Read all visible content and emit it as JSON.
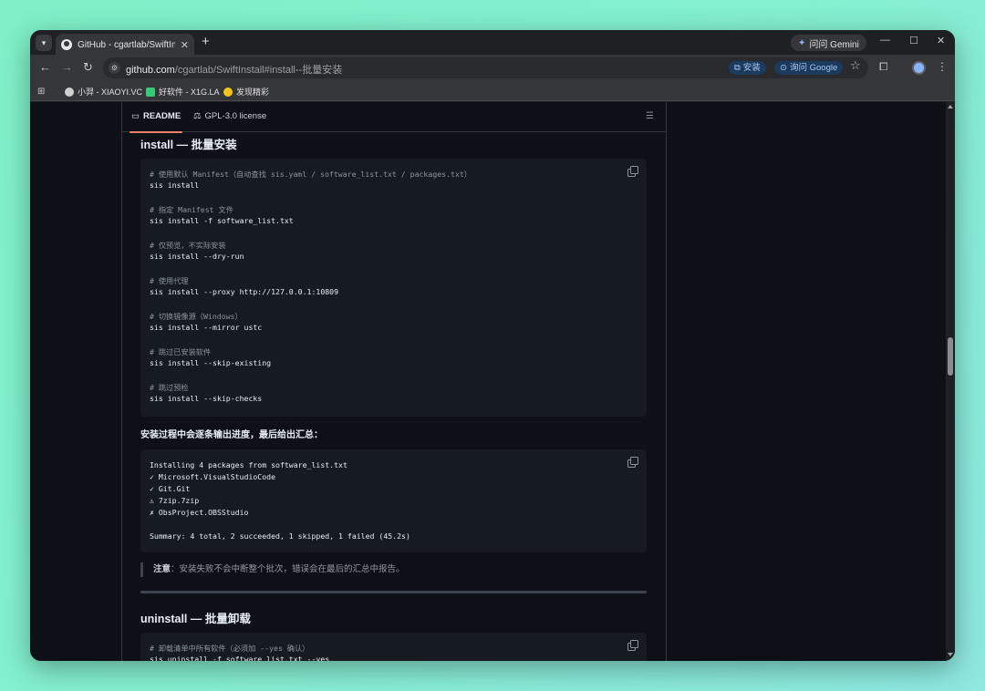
{
  "browser": {
    "tab_title": "GitHub - cgartlab/SwiftInstall",
    "gemini_label": "问问 Gemini",
    "url_host": "github.com",
    "url_path": "/cgartlab/SwiftInstall#install--批量安装",
    "install_chip": "安装",
    "google_chip": "询问 Google",
    "bookmarks": [
      {
        "label": "小羿 - XIAOYI.VC"
      },
      {
        "label": "好软件 - X1G.LA"
      },
      {
        "label": "发现精彩"
      }
    ]
  },
  "readme": {
    "tab_readme": "README",
    "tab_license": "GPL-3.0 license"
  },
  "install_section": {
    "title": "install — 批量安装",
    "code_lines": [
      {
        "text": "# 使用默认 Manifest（自动查找 sis.yaml / software_list.txt / packages.txt）",
        "kind": "cmt"
      },
      {
        "text": "sis install",
        "kind": "cmd"
      },
      {
        "text": "# 指定 Manifest 文件",
        "kind": "cmt"
      },
      {
        "text": "sis install -f software_list.txt",
        "kind": "cmd"
      },
      {
        "text": "# 仅预览，不实际安装",
        "kind": "cmt"
      },
      {
        "text": "sis install --dry-run",
        "kind": "cmd"
      },
      {
        "text": "# 使用代理",
        "kind": "cmt"
      },
      {
        "text": "sis install --proxy http://127.0.0.1:10809",
        "kind": "cmd"
      },
      {
        "text": "# 切换镜像源（Windows）",
        "kind": "cmt"
      },
      {
        "text": "sis install --mirror ustc",
        "kind": "cmd"
      },
      {
        "text": "# 跳过已安装软件",
        "kind": "cmt"
      },
      {
        "text": "sis install --skip-existing",
        "kind": "cmd"
      },
      {
        "text": "# 跳过预检",
        "kind": "cmt"
      },
      {
        "text": "sis install --skip-checks",
        "kind": "cmd"
      }
    ],
    "progress_note": "安装过程中会逐条输出进度，最后给出汇总：",
    "output_lines": [
      "Installing 4 packages from software_list.txt",
      "  ✓ Microsoft.VisualStudioCode",
      "  ✓ Git.Git",
      "  ⚠ 7zip.7zip",
      "  ✗ ObsProject.OBSStudio",
      "Summary: 4 total, 2 succeeded, 1 skipped, 1 failed (45.2s)"
    ],
    "note_label": "注意",
    "note_text": "：安装失败不会中断整个批次，错误会在最后的汇总中报告。"
  },
  "uninstall_section": {
    "title": "uninstall — 批量卸载",
    "code_lines": [
      {
        "text": "# 卸载清单中所有软件（必须加 --yes 确认）",
        "kind": "cmt"
      },
      {
        "text": "sis uninstall -f software_list.txt --yes",
        "kind": "cmd"
      }
    ]
  }
}
